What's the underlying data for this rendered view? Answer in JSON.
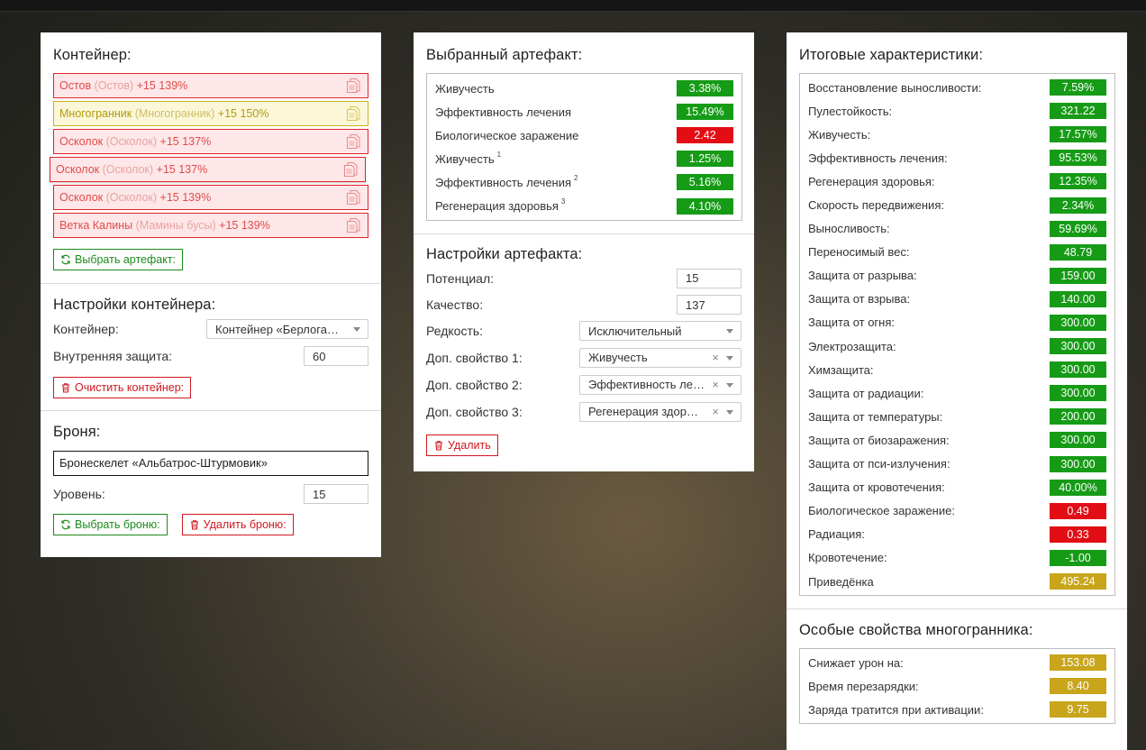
{
  "container": {
    "title": "Контейнер:",
    "items": [
      {
        "name": "Остов",
        "alias": "(Остов)",
        "bonus": "+15 139%",
        "color": "red"
      },
      {
        "name": "Многогранник",
        "alias": "(Многогранник)",
        "bonus": "+15 150%",
        "color": "yellow"
      },
      {
        "name": "Осколок",
        "alias": "(Осколок)",
        "bonus": "+15 137%",
        "color": "red"
      },
      {
        "name": "Осколок",
        "alias": "(Осколок)",
        "bonus": "+15 137%",
        "color": "red"
      },
      {
        "name": "Осколок",
        "alias": "(Осколок)",
        "bonus": "+15 139%",
        "color": "red"
      },
      {
        "name": "Ветка Калины",
        "alias": "(Мамины бусы)",
        "bonus": "+15 139%",
        "color": "red"
      }
    ],
    "select_artifact_label": "Выбрать артефакт:"
  },
  "container_settings": {
    "title": "Настройки контейнера:",
    "container_label": "Контейнер:",
    "container_value": "Контейнер «Берлога…",
    "protection_label": "Внутренняя защита:",
    "protection_value": "60",
    "clear_label": "Очистить контейнер:"
  },
  "armor": {
    "title": "Броня:",
    "name": "Бронескелет «Альбатрос-Штурмовик»",
    "level_label": "Уровень:",
    "level_value": "15",
    "select_label": "Выбрать броню:",
    "delete_label": "Удалить броню:"
  },
  "selected_artifact": {
    "title": "Выбранный артефакт:",
    "stats": [
      {
        "label": "Живучесть",
        "sup": "",
        "value": "3.38%",
        "color": "g"
      },
      {
        "label": "Эффективность лечения",
        "sup": "",
        "value": "15.49%",
        "color": "g"
      },
      {
        "label": "Биологическое заражение",
        "sup": "",
        "value": "2.42",
        "color": "r"
      },
      {
        "label": "Живучесть",
        "sup": "1",
        "value": "1.25%",
        "color": "g"
      },
      {
        "label": "Эффективность лечения",
        "sup": "2",
        "value": "5.16%",
        "color": "g"
      },
      {
        "label": "Регенерация здоровья",
        "sup": "3",
        "value": "4.10%",
        "color": "g"
      }
    ]
  },
  "artifact_settings": {
    "title": "Настройки артефакта:",
    "potential_label": "Потенциал:",
    "potential_value": "15",
    "quality_label": "Качество:",
    "quality_value": "137",
    "rarity_label": "Редкость:",
    "rarity_value": "Исключительный",
    "prop1_label": "Доп. свойство 1:",
    "prop1_value": "Живучесть",
    "prop2_label": "Доп. свойство 2:",
    "prop2_value": "Эффективность ле…",
    "prop3_label": "Доп. свойство 3:",
    "prop3_value": "Регенерация здор…",
    "clear_symbol": "×",
    "delete_label": "Удалить"
  },
  "totals": {
    "title": "Итоговые характеристики:",
    "stats": [
      {
        "label": "Восстановление выносливости:",
        "value": "7.59%",
        "color": "g"
      },
      {
        "label": "Пулестойкость:",
        "value": "321.22",
        "color": "g"
      },
      {
        "label": "Живучесть:",
        "value": "17.57%",
        "color": "g"
      },
      {
        "label": "Эффективность лечения:",
        "value": "95.53%",
        "color": "g"
      },
      {
        "label": "Регенерация здоровья:",
        "value": "12.35%",
        "color": "g"
      },
      {
        "label": "Скорость передвижения:",
        "value": "2.34%",
        "color": "g"
      },
      {
        "label": "Выносливость:",
        "value": "59.69%",
        "color": "g"
      },
      {
        "label": "Переносимый вес:",
        "value": "48.79",
        "color": "g"
      },
      {
        "label": "Защита от разрыва:",
        "value": "159.00",
        "color": "g"
      },
      {
        "label": "Защита от взрыва:",
        "value": "140.00",
        "color": "g"
      },
      {
        "label": "Защита от огня:",
        "value": "300.00",
        "color": "g"
      },
      {
        "label": "Электрозащита:",
        "value": "300.00",
        "color": "g"
      },
      {
        "label": "Химзащита:",
        "value": "300.00",
        "color": "g"
      },
      {
        "label": "Защита от радиации:",
        "value": "300.00",
        "color": "g"
      },
      {
        "label": "Защита от температуры:",
        "value": "200.00",
        "color": "g"
      },
      {
        "label": "Защита от биозаражения:",
        "value": "300.00",
        "color": "g"
      },
      {
        "label": "Защита от пси-излучения:",
        "value": "300.00",
        "color": "g"
      },
      {
        "label": "Защита от кровотечения:",
        "value": "40.00%",
        "color": "g"
      },
      {
        "label": "Биологическое заражение:",
        "value": "0.49",
        "color": "r"
      },
      {
        "label": "Радиация:",
        "value": "0.33",
        "color": "r"
      },
      {
        "label": "Кровотечение:",
        "value": "-1.00",
        "color": "g"
      },
      {
        "label": "Приведёнка",
        "value": "495.24",
        "color": "y"
      }
    ]
  },
  "polyhedron": {
    "title": "Особые свойства многогранника:",
    "stats": [
      {
        "label": "Снижает урон на:",
        "value": "153.08",
        "color": "y"
      },
      {
        "label": "Время перезарядки:",
        "value": "8.40",
        "color": "y"
      },
      {
        "label": "Заряда тратится при активации:",
        "value": "9.75",
        "color": "y"
      }
    ]
  },
  "colors": {
    "green": "#169b16",
    "red": "#e30e15",
    "yellow": "#c8a51a",
    "button_green": "#1b8a1b",
    "button_red": "#d0181e"
  }
}
